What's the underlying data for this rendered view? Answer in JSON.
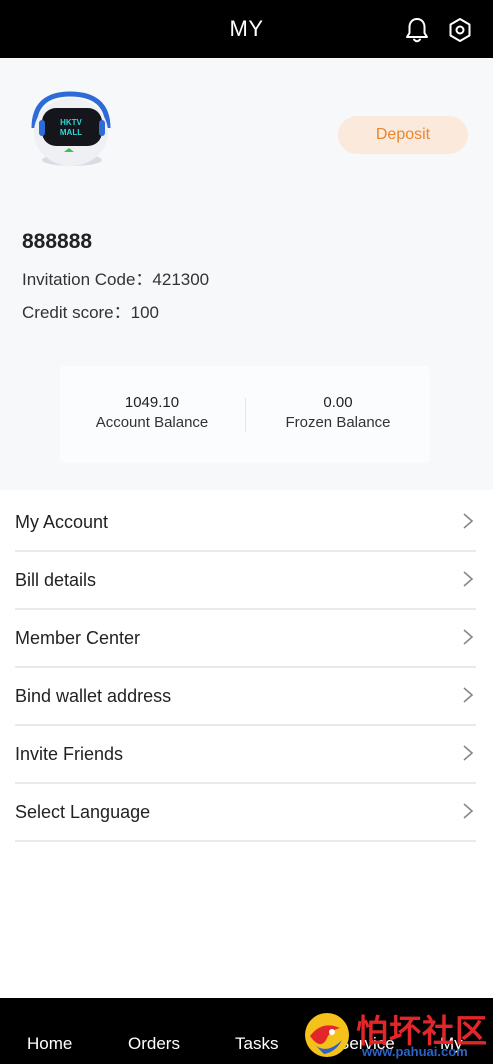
{
  "header": {
    "title": "MY",
    "notification_icon": "bell-icon",
    "settings_icon": "gear-icon"
  },
  "profile": {
    "avatar_text_line1": "HKTV",
    "avatar_text_line2": "MALL",
    "deposit_label": "Deposit",
    "username": "888888",
    "invitation_code_label": "Invitation Code：421300",
    "credit_score_label": "Credit score：100"
  },
  "balances": {
    "account_balance_value": "1049.10",
    "account_balance_label": "Account Balance",
    "frozen_balance_value": "0.00",
    "frozen_balance_label": "Frozen Balance"
  },
  "menu": {
    "items": [
      {
        "label": "My Account"
      },
      {
        "label": "Bill details"
      },
      {
        "label": "Member Center"
      },
      {
        "label": "Bind wallet address"
      },
      {
        "label": "Invite Friends"
      },
      {
        "label": "Select Language"
      }
    ],
    "chevron_icon": "chevron-right-icon"
  },
  "tabbar": {
    "home": "Home",
    "orders": "Orders",
    "tasks": "Tasks",
    "service": "Service",
    "my": "My"
  },
  "watermark": {
    "text": "怕坏社区",
    "url": "www.pahuai.com"
  },
  "colors": {
    "header_bg": "#000000",
    "profile_bg": "#f7f8fa",
    "deposit_bg": "#fbe9dc",
    "deposit_text": "#e8872f",
    "divider": "#e9eaec",
    "watermark_red": "#e2262a",
    "watermark_blue": "#2d63c8"
  }
}
